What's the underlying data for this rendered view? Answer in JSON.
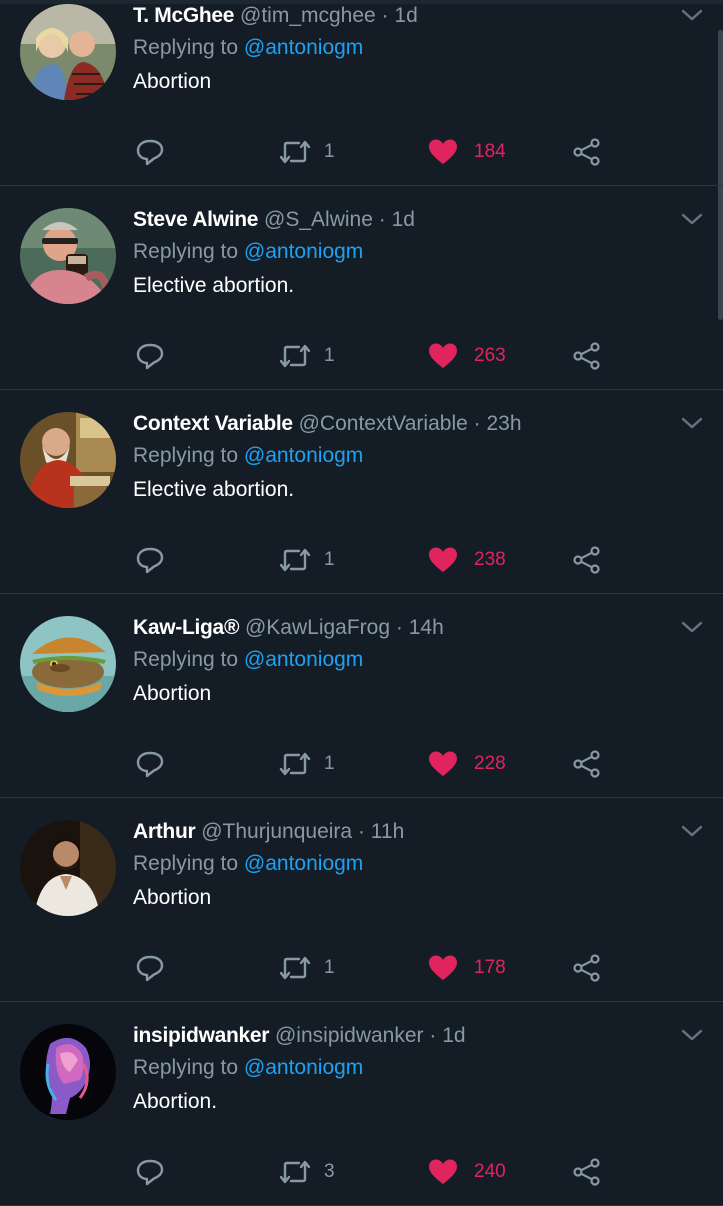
{
  "accent_colors": {
    "background": "#141d26",
    "link": "#1da1f2",
    "like": "#e0245e",
    "muted": "#8899a6"
  },
  "tweets": [
    {
      "name": "T. McGhee",
      "handle": "@tim_mcghee",
      "separator": "·",
      "time": "1d",
      "replying_prefix": "Replying to",
      "replying_to": "@antoniogm",
      "text": "Abortion",
      "retweets": "1",
      "likes": "184",
      "icons": [
        "reply-icon",
        "retweet-icon",
        "heart-icon",
        "share-icon"
      ]
    },
    {
      "name": "Steve Alwine",
      "handle": "@S_Alwine",
      "separator": "·",
      "time": "1d",
      "replying_prefix": "Replying to",
      "replying_to": "@antoniogm",
      "text": "Elective abortion.",
      "retweets": "1",
      "likes": "263"
    },
    {
      "name": "Context Variable",
      "handle": "@ContextVariable",
      "separator": "·",
      "time": "23h",
      "replying_prefix": "Replying to",
      "replying_to": "@antoniogm",
      "text": "Elective abortion.",
      "retweets": "1",
      "likes": "238"
    },
    {
      "name": "Kaw-Liga®",
      "handle": "@KawLigaFrog",
      "separator": "·",
      "time": "14h",
      "replying_prefix": "Replying to",
      "replying_to": "@antoniogm",
      "text": "Abortion",
      "retweets": "1",
      "likes": "228"
    },
    {
      "name": "Arthur",
      "handle": "@Thurjunqueira",
      "separator": "·",
      "time": "11h",
      "replying_prefix": "Replying to",
      "replying_to": "@antoniogm",
      "text": "Abortion",
      "retweets": "1",
      "likes": "178"
    },
    {
      "name": "insipidwanker",
      "handle": "@insipidwanker",
      "separator": "·",
      "time": "1d",
      "replying_prefix": "Replying to",
      "replying_to": "@antoniogm",
      "text": "Abortion.",
      "retweets": "3",
      "likes": "240"
    }
  ]
}
